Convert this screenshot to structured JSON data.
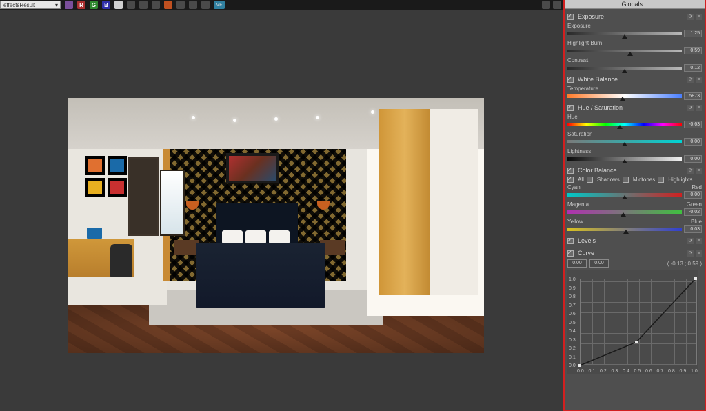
{
  "toolbar": {
    "channel_dropdown": "effectsResult",
    "icons": [
      "V",
      "R",
      "G",
      "B",
      "●",
      "□",
      "▦",
      "▣",
      "◉",
      "✦",
      "⊞",
      "◐",
      "VF"
    ]
  },
  "panel": {
    "title": "Globals...",
    "exposure": {
      "name": "Exposure",
      "sliders": [
        {
          "label": "Exposure",
          "value": "1.25",
          "pos": 50
        },
        {
          "label": "Highlight Burn",
          "value": "0.59",
          "pos": 55
        },
        {
          "label": "Contrast",
          "value": "0.12",
          "pos": 50
        }
      ]
    },
    "whitebalance": {
      "name": "White Balance",
      "sliders": [
        {
          "label": "Temperature",
          "value": "5873",
          "pos": 48,
          "t": "temp"
        }
      ]
    },
    "huesat": {
      "name": "Hue / Saturation",
      "sliders": [
        {
          "label": "Hue",
          "value": "-0.63",
          "pos": 46,
          "t": "hue"
        },
        {
          "label": "Saturation",
          "value": "0.00",
          "pos": 50,
          "t": "sat"
        },
        {
          "label": "Lightness",
          "value": "0.00",
          "pos": 50,
          "t": "light"
        }
      ]
    },
    "colorbalance": {
      "name": "Color Balance",
      "check_labels": {
        "all": "All",
        "shadows": "Shadows",
        "mid": "Midtones",
        "hi": "Highlights"
      },
      "sliders": [
        {
          "label": "Cyan",
          "label2": "Red",
          "value": "0.00",
          "pos": 50,
          "t": "cyanred"
        },
        {
          "label": "Magenta",
          "label2": "Green",
          "value": "-0.02",
          "pos": 49,
          "t": "maggrn"
        },
        {
          "label": "Yellow",
          "label2": "Blue",
          "value": "0.03",
          "pos": 51,
          "t": "yelblu"
        }
      ]
    },
    "levels": {
      "name": "Levels"
    },
    "curve": {
      "name": "Curve",
      "in": "0.00",
      "out": "0.00",
      "coord": "( -0.13 ; 0.59 )",
      "yticks": [
        "1.0",
        "0.9",
        "0.8",
        "0.7",
        "0.6",
        "0.5",
        "0.4",
        "0.3",
        "0.2",
        "0.1",
        "0.0"
      ],
      "xticks": [
        "0.0",
        "0.1",
        "0.2",
        "0.3",
        "0.4",
        "0.5",
        "0.6",
        "0.7",
        "0.8",
        "0.9",
        "1.0"
      ]
    }
  }
}
